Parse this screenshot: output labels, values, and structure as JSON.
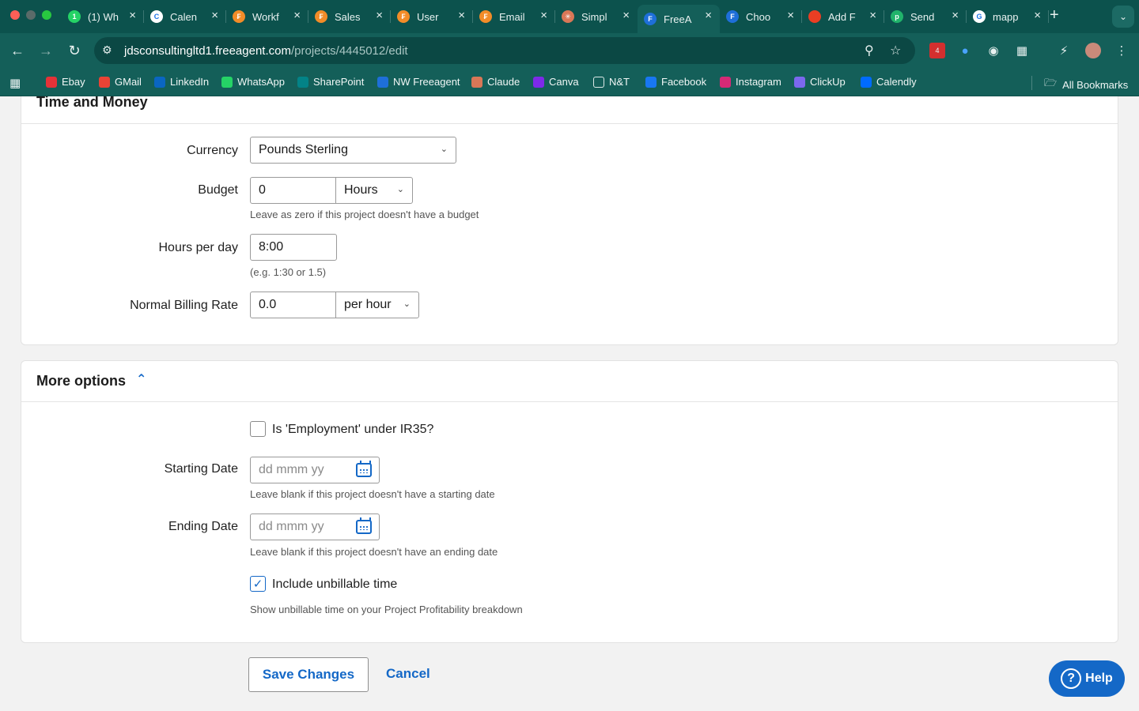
{
  "browser": {
    "tabs": [
      {
        "title": "(1) Wh",
        "icon": "whatsapp-icon",
        "color": "#25d366",
        "glyph": "1"
      },
      {
        "title": "Calen",
        "icon": "calendar-icon",
        "color": "#ffffff",
        "glyph": "C"
      },
      {
        "title": "Workf",
        "icon": "freeagent-icon",
        "color": "#f28c28",
        "glyph": "₣"
      },
      {
        "title": "Sales",
        "icon": "freeagent-icon",
        "color": "#f28c28",
        "glyph": "₣"
      },
      {
        "title": "User",
        "icon": "freeagent-icon",
        "color": "#f28c28",
        "glyph": "₣"
      },
      {
        "title": "Email",
        "icon": "freeagent-icon",
        "color": "#f28c28",
        "glyph": "₣"
      },
      {
        "title": "Simpl",
        "icon": "claude-icon",
        "color": "#d97757",
        "glyph": "✳"
      },
      {
        "title": "FreeA",
        "icon": "freeagent-blue-icon",
        "color": "#1e6fd9",
        "glyph": "F"
      },
      {
        "title": "Choo",
        "icon": "freeagent-blue-icon",
        "color": "#1e6fd9",
        "glyph": "F"
      },
      {
        "title": "Add F",
        "icon": "office-icon",
        "color": "#ea3e23",
        "glyph": ""
      },
      {
        "title": "Send",
        "icon": "p-icon",
        "color": "#21b36b",
        "glyph": "p"
      },
      {
        "title": "mapp",
        "icon": "google-icon",
        "color": "#ffffff",
        "glyph": "G"
      }
    ],
    "active_tab": 7,
    "url_domain": "jdsconsultingltd1.freeagent.com",
    "url_path": "/projects/4445012/edit",
    "extension_badge": "4",
    "bookmarks": [
      {
        "label": "Ebay",
        "icon": "ebay-icon",
        "color": "#e53238"
      },
      {
        "label": "GMail",
        "icon": "gmail-icon",
        "color": "#ea4335"
      },
      {
        "label": "LinkedIn",
        "icon": "linkedin-icon",
        "color": "#0a66c2"
      },
      {
        "label": "WhatsApp",
        "icon": "whatsapp-icon",
        "color": "#25d366"
      },
      {
        "label": "SharePoint",
        "icon": "sharepoint-icon",
        "color": "#038387"
      },
      {
        "label": "NW Freeagent",
        "icon": "freeagent-blue-icon",
        "color": "#1e6fd9"
      },
      {
        "label": "Claude",
        "icon": "claude-icon",
        "color": "#d97757"
      },
      {
        "label": "Canva",
        "icon": "canva-icon",
        "color": "#7d2ae8"
      },
      {
        "label": "N&T",
        "icon": "folder-icon",
        "color": "#145f59"
      },
      {
        "label": "Facebook",
        "icon": "facebook-icon",
        "color": "#1877f2"
      },
      {
        "label": "Instagram",
        "icon": "instagram-icon",
        "color": "#d62976"
      },
      {
        "label": "ClickUp",
        "icon": "clickup-icon",
        "color": "#7b68ee"
      },
      {
        "label": "Calendly",
        "icon": "calendly-icon",
        "color": "#006bff"
      }
    ],
    "all_bookmarks": "All Bookmarks"
  },
  "time_money": {
    "title": "Time and Money",
    "currency_label": "Currency",
    "currency_value": "Pounds Sterling",
    "budget_label": "Budget",
    "budget_value": "0",
    "budget_unit": "Hours",
    "budget_hint": "Leave as zero if this project doesn't have a budget",
    "hours_label": "Hours per day",
    "hours_value": "8:00",
    "hours_hint": "(e.g. 1:30 or 1.5)",
    "rate_label": "Normal Billing Rate",
    "rate_value": "0.0",
    "rate_unit": "per hour"
  },
  "more_options": {
    "title": "More options",
    "ir35_label": "Is 'Employment' under IR35?",
    "ir35_checked": false,
    "start_label": "Starting Date",
    "start_placeholder": "dd mmm yy",
    "start_hint": "Leave blank if this project doesn't have a starting date",
    "end_label": "Ending Date",
    "end_placeholder": "dd mmm yy",
    "end_hint": "Leave blank if this project doesn't have an ending date",
    "unbillable_label": "Include unbillable time",
    "unbillable_checked": true,
    "unbillable_hint": "Show unbillable time on your Project Profitability breakdown"
  },
  "actions": {
    "save_label": "Save Changes",
    "cancel_label": "Cancel",
    "help_label": "Help"
  },
  "colors": {
    "chrome_frame": "#0c524d",
    "chrome_toolbar": "#145f59",
    "accent": "#1468c7"
  }
}
